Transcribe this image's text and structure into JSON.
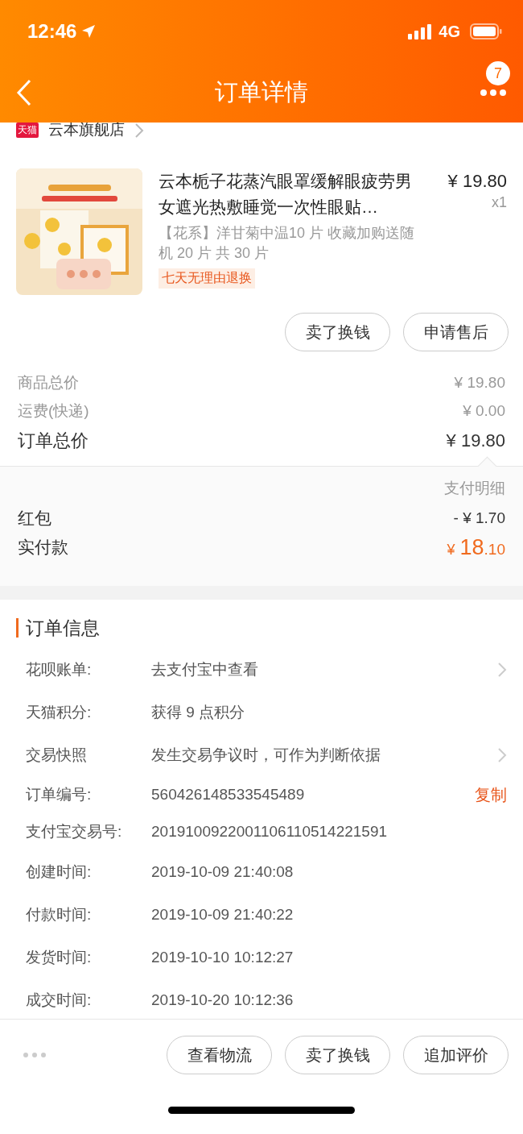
{
  "status_bar": {
    "time": "12:46",
    "network": "4G"
  },
  "nav": {
    "title": "订单详情",
    "badge": "7"
  },
  "store": {
    "badge": "天猫",
    "name": "云本旗舰店"
  },
  "product": {
    "title": "云本栀子花蒸汽眼罩缓解眼疲劳男女遮光热敷睡觉一次性眼贴…",
    "price": "¥ 19.80",
    "quantity": "x1",
    "sku": "【花系】洋甘菊中温10 片 收藏加购送随机 20 片 共 30 片",
    "tag": "七天无理由退换",
    "actions": [
      "卖了换钱",
      "申请售后"
    ]
  },
  "price_rows": [
    {
      "kind": "minor",
      "label": "商品总价",
      "value": "¥ 19.80"
    },
    {
      "kind": "minor",
      "label": "运费(快递)",
      "value": "¥ 0.00"
    },
    {
      "kind": "total",
      "label": "订单总价",
      "value": "¥ 19.80"
    }
  ],
  "payment": {
    "title": "支付明细",
    "discount_label": "红包",
    "discount_value": "- ¥ 1.70",
    "paid_label": "实付款",
    "paid_amount": {
      "currency": "¥",
      "integer": "18",
      "decimal": ".10"
    }
  },
  "order_info": {
    "title": "订单信息",
    "rows": [
      {
        "label": "花呗账单:",
        "value": "去支付宝中查看",
        "kind": "link"
      },
      {
        "label": "天猫积分:",
        "value": "获得 9 点积分",
        "kind": "plain"
      },
      {
        "label": "交易快照",
        "value": "发生交易争议时，可作为判断依据",
        "kind": "link"
      },
      {
        "label": "订单编号:",
        "value": "560426148533545489",
        "kind": "copy",
        "action": "复制"
      },
      {
        "label": "支付宝交易号:",
        "value": "2019100922001106110514221591",
        "kind": "plain"
      },
      {
        "label": "创建时间:",
        "value": "2019-10-09 21:40:08",
        "kind": "plain"
      },
      {
        "label": "付款时间:",
        "value": "2019-10-09 21:40:22",
        "kind": "plain"
      },
      {
        "label": "发货时间:",
        "value": "2019-10-10 10:12:27",
        "kind": "plain"
      },
      {
        "label": "成交时间:",
        "value": "2019-10-20 10:12:36",
        "kind": "plain"
      }
    ]
  },
  "bottom_actions": [
    "查看物流",
    "卖了换钱",
    "追加评价"
  ]
}
